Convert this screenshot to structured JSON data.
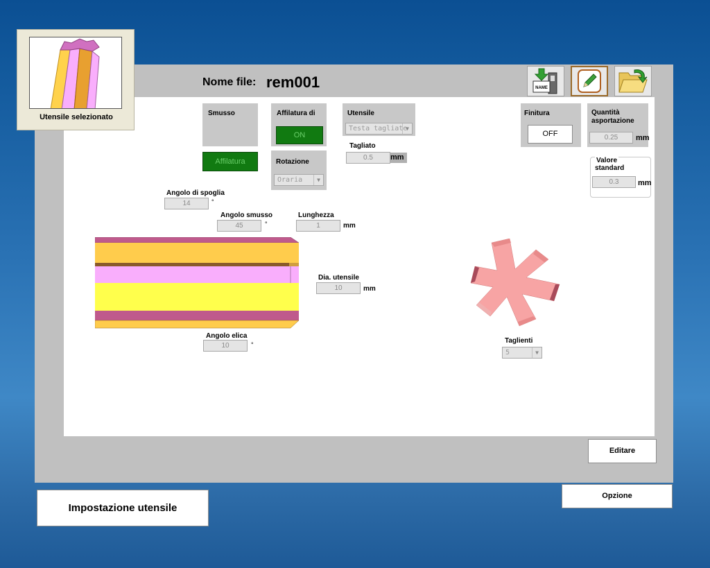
{
  "header": {
    "file_label": "Nome file:",
    "file_name": "rem001"
  },
  "toolbar": {
    "items": [
      {
        "icon": "save-name-icon"
      },
      {
        "icon": "edit-pencil-icon",
        "selected": true
      },
      {
        "icon": "open-folder-icon"
      }
    ],
    "save_icon_text": "NAME"
  },
  "thumbnail": {
    "label": "Utensile selezionato"
  },
  "smusso": {
    "title": "Smusso",
    "button": "Affilatura"
  },
  "affilatura": {
    "title": "Affilatura di",
    "state": "ON"
  },
  "rotazione": {
    "title": "Rotazione",
    "value": "Oraria"
  },
  "utensile": {
    "title": "Utensile",
    "value": "Testa tagliate"
  },
  "tagliato": {
    "label": "Tagliato",
    "value": "0.5",
    "unit": "mm"
  },
  "finitura": {
    "title": "Finitura",
    "state": "OFF"
  },
  "quantita": {
    "title_line1": "Quantità",
    "title_line2": "asportazione",
    "value": "0.25",
    "unit": "mm"
  },
  "valore_standard": {
    "title_line1": "Valore",
    "title_line2": "standard",
    "value": "0.3",
    "unit": "mm"
  },
  "angolo_spoglia": {
    "label": "Angolo di spoglia",
    "value": "14",
    "unit": "°"
  },
  "angolo_smusso": {
    "label": "Angolo smusso",
    "value": "45",
    "unit": "°"
  },
  "lunghezza": {
    "label": "Lunghezza",
    "value": "1",
    "unit": "mm"
  },
  "dia_utensile": {
    "label": "Dia. utensile",
    "value": "10",
    "unit": "mm"
  },
  "angolo_elica": {
    "label": "Angolo elica",
    "value": "10",
    "unit": "°"
  },
  "taglienti": {
    "label": "Taglienti",
    "value": "5"
  },
  "buttons": {
    "editare": "Editare",
    "opzione": "Opzione"
  },
  "title_box": {
    "label": "Impostazione utensile"
  },
  "colors": {
    "tool_yellow": "#ffff4c",
    "tool_orange": "#ffcc4c",
    "tool_pink": "#f9aefc",
    "tool_magenta": "#bf5a8c",
    "gear_pink": "#f7a4a4",
    "green_button": "#117a11"
  }
}
